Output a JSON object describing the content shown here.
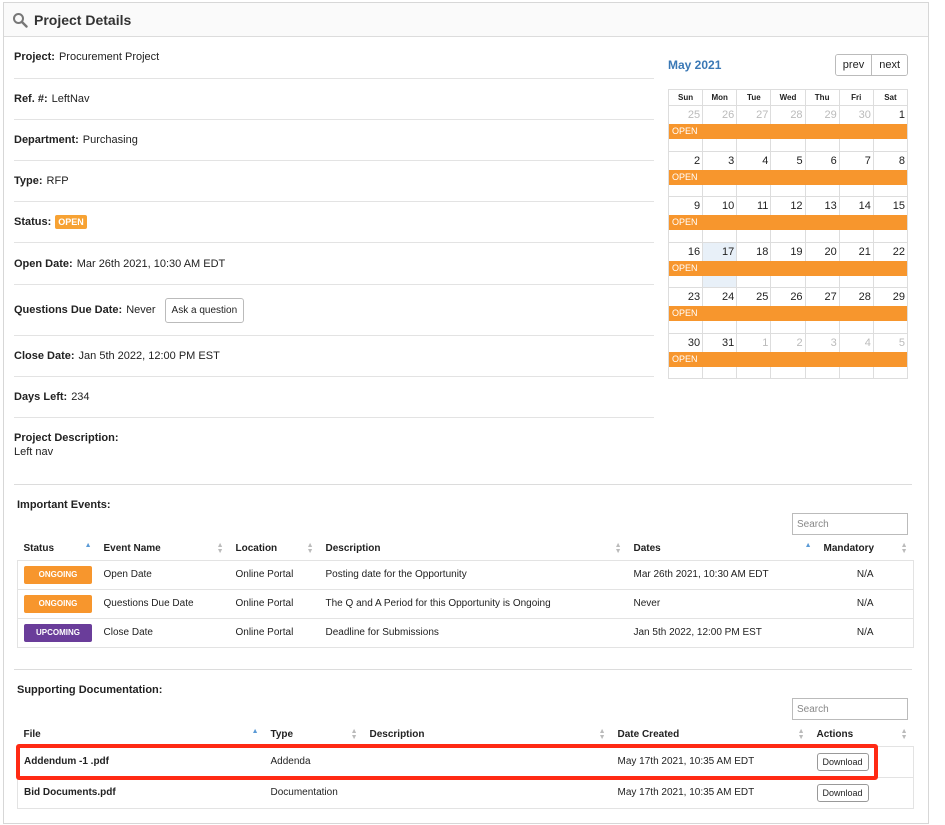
{
  "header": {
    "title": "Project Details",
    "icon": "search-icon"
  },
  "details": {
    "project": {
      "label": "Project:",
      "value": "Procurement Project"
    },
    "ref": {
      "label": "Ref. #:",
      "value": "LeftNav"
    },
    "department": {
      "label": "Department:",
      "value": "Purchasing"
    },
    "type": {
      "label": "Type:",
      "value": "RFP"
    },
    "status": {
      "label": "Status:",
      "value": "OPEN"
    },
    "open_date": {
      "label": "Open Date:",
      "value": "Mar 26th 2021, 10:30 AM EDT"
    },
    "questions_due": {
      "label": "Questions Due Date:",
      "value": "Never",
      "button": "Ask a question"
    },
    "close_date": {
      "label": "Close Date:",
      "value": "Jan 5th 2022, 12:00 PM EST"
    },
    "days_left": {
      "label": "Days Left:",
      "value": "234"
    },
    "description": {
      "label": "Project Description:",
      "value": "Left nav"
    }
  },
  "calendar": {
    "title": "May 2021",
    "prev": "prev",
    "next": "next",
    "days_of_week": [
      "Sun",
      "Mon",
      "Tue",
      "Wed",
      "Thu",
      "Fri",
      "Sat"
    ],
    "event_label": "OPEN",
    "weeks": [
      [
        "25",
        "26",
        "27",
        "28",
        "29",
        "30",
        "1"
      ],
      [
        "2",
        "3",
        "4",
        "5",
        "6",
        "7",
        "8"
      ],
      [
        "9",
        "10",
        "11",
        "12",
        "13",
        "14",
        "15"
      ],
      [
        "16",
        "17",
        "18",
        "19",
        "20",
        "21",
        "22"
      ],
      [
        "23",
        "24",
        "25",
        "26",
        "27",
        "28",
        "29"
      ],
      [
        "30",
        "31",
        "1",
        "2",
        "3",
        "4",
        "5"
      ]
    ],
    "today": "17",
    "colors": {
      "event": "#f7962d",
      "title": "#3a78b5",
      "today_bg": "#e8f0f8"
    }
  },
  "events": {
    "title": "Important Events:",
    "search_placeholder": "Search",
    "columns": [
      "Status",
      "Event Name",
      "Location",
      "Description",
      "Dates",
      "Mandatory"
    ],
    "rows": [
      {
        "status": "ONGOING",
        "name": "Open Date",
        "location": "Online Portal",
        "description": "Posting date for the Opportunity",
        "dates": "Mar 26th 2021, 10:30 AM EDT",
        "mandatory": "N/A"
      },
      {
        "status": "ONGOING",
        "name": "Questions Due Date",
        "location": "Online Portal",
        "description": "The Q and A Period for this Opportunity is Ongoing",
        "dates": "Never",
        "mandatory": "N/A"
      },
      {
        "status": "UPCOMING",
        "name": "Close Date",
        "location": "Online Portal",
        "description": "Deadline for Submissions",
        "dates": "Jan 5th 2022, 12:00 PM EST",
        "mandatory": "N/A"
      }
    ],
    "colors": {
      "ongoing": "#f7962d",
      "upcoming": "#6a3d9a"
    }
  },
  "docs": {
    "title": "Supporting Documentation:",
    "search_placeholder": "Search",
    "columns": [
      "File",
      "Type",
      "Description",
      "Date Created",
      "Actions"
    ],
    "rows": [
      {
        "file": "Addendum -1 .pdf",
        "type": "Addenda",
        "description": "",
        "date": "May 17th 2021, 10:35 AM EDT",
        "action": "Download"
      },
      {
        "file": "Bid Documents.pdf",
        "type": "Documentation",
        "description": "",
        "date": "May 17th 2021, 10:35 AM EDT",
        "action": "Download"
      }
    ],
    "highlight_color": "#ff2a14"
  }
}
